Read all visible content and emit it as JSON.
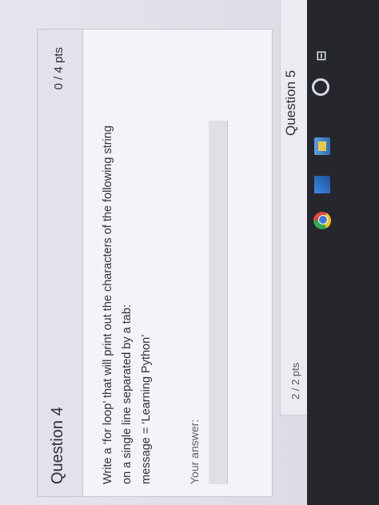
{
  "question4": {
    "title": "Question 4",
    "points": "0 / 4 pts",
    "text_lines": [
      "Write a ‘for loop’ that will print out the characters of the following string",
      "on a single line separated by a tab:",
      "message = ‘Learning Python’"
    ],
    "answer_label": "Your answer:",
    "answer_value": ""
  },
  "question5": {
    "title": "Question 5",
    "points": "2 / 2 pts"
  },
  "taskbar": {
    "search_icon": "search-icon",
    "taskview_icon": "task-view-icon",
    "taskview_glyph": "⊟",
    "apps": [
      "file-explorer-icon",
      "photos-icon",
      "chrome-icon"
    ]
  }
}
